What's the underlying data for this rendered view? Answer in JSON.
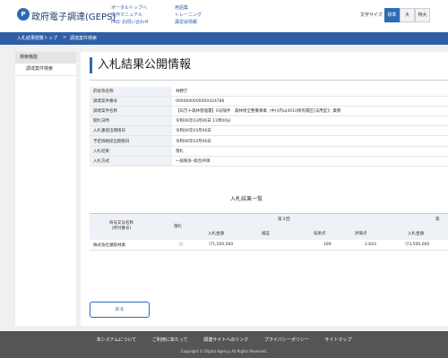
{
  "header": {
    "logo_mark": "P",
    "logo_text": "政府電子調達(GEPS)",
    "nav_col1": [
      "ポータルトップへ",
      "操作マニュアル",
      "FAQ･お問い合わせ"
    ],
    "nav_col2": [
      "用語集",
      "トレーニング",
      "講習会情報"
    ],
    "font_size_label": "文字サイズ",
    "font_sizes": [
      "標準",
      "大",
      "特大"
    ],
    "font_size_selected": "標準"
  },
  "breadcrumb": [
    "入札結果閲覧トップ",
    ">",
    "調達案件検索"
  ],
  "sidebar": {
    "heading": "検索機能",
    "items": [
      "調達案件検索"
    ]
  },
  "main": {
    "title": "入札結果公開情報",
    "info_rows": [
      {
        "label": "府省等名称",
        "value": "林野庁"
      },
      {
        "label": "調達案件番号",
        "value": "0000000000000424786"
      },
      {
        "label": "調達案件名称",
        "value": "【白万十森林管理署】6号険件　森林保全整備事業（中川内山4010保有開区[法用型]）業務"
      },
      {
        "label": "開札日時",
        "value": "令和06年03月06日 11時00分"
      },
      {
        "label": "入札書提出期限日",
        "value": "令和06年03月06日"
      },
      {
        "label": "予定価格提出期限日",
        "value": "令和06年03月06日"
      },
      {
        "label": "入札結果",
        "value": "落札"
      },
      {
        "label": "入札方式",
        "value": "一般競争･総合評価"
      }
    ],
    "list_title": "入札結果一覧",
    "result_header": {
      "bidder": "商号又は名称\n(所付番号)",
      "award": "落札",
      "round": "第３回",
      "bid_amount": "入札金額",
      "check": "検証",
      "tech_score": "技術点",
      "eval_score": "評価点",
      "bid_amount2": "入札金額",
      "cut_mark": "第"
    },
    "result_rows": [
      {
        "bidder": "株式会社瀬阪林業",
        "award": "○",
        "bid_amount": "\\71,500,000",
        "check": "",
        "tech_score": "189",
        "eval_score": "2.643",
        "bid_amount2": "\\73,500,000"
      }
    ],
    "back_label": "戻る"
  },
  "footer": {
    "links": [
      "本システムについて",
      "ご利用にあたって",
      "関連サイトへのリンク",
      "プライバシーポリシー",
      "サイトマップ"
    ],
    "copyright": "Copyright © Digital Agency All Rights Reserved."
  }
}
